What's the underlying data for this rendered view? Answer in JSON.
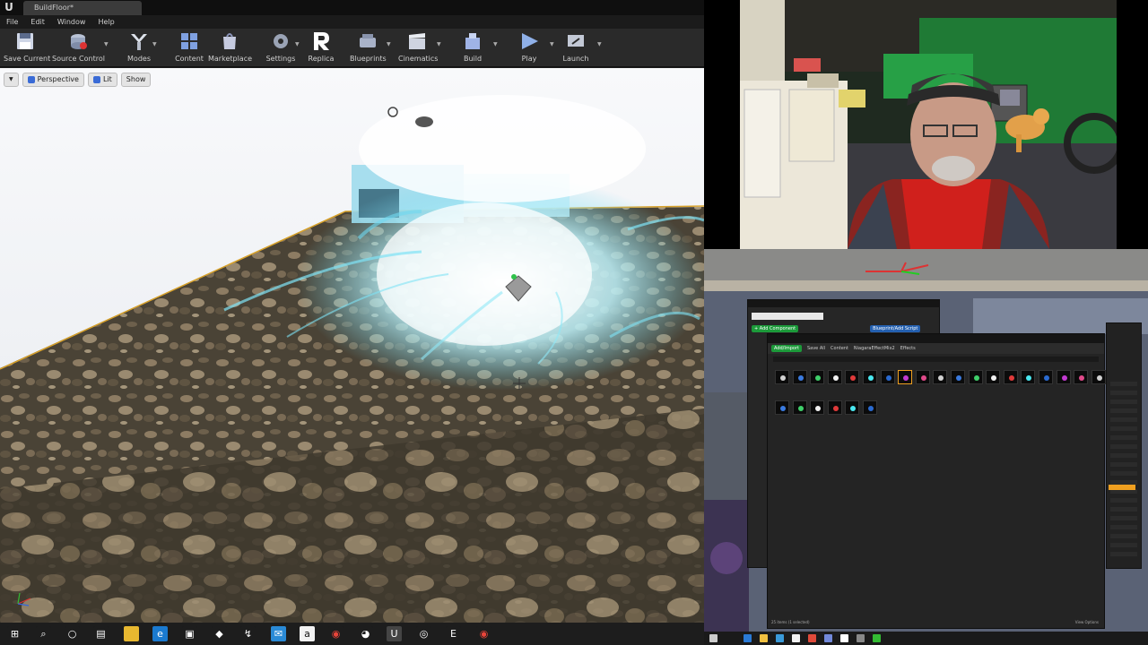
{
  "editor": {
    "tab_title": "BuildFloor*",
    "menu": [
      "File",
      "Edit",
      "Window",
      "Help"
    ],
    "toolbar": [
      {
        "label": "Save Current",
        "icon": "save-icon",
        "caret": false
      },
      {
        "label": "Source Control",
        "icon": "source-control-icon",
        "caret": true
      },
      {
        "label": "Modes",
        "icon": "modes-icon",
        "caret": true
      },
      {
        "label": "Content",
        "icon": "content-icon",
        "caret": false
      },
      {
        "label": "Marketplace",
        "icon": "marketplace-icon",
        "caret": false
      },
      {
        "label": "Settings",
        "icon": "settings-icon",
        "caret": true
      },
      {
        "label": "Replica",
        "icon": "replica-icon",
        "caret": false
      },
      {
        "label": "Blueprints",
        "icon": "blueprints-icon",
        "caret": true
      },
      {
        "label": "Cinematics",
        "icon": "cinematics-icon",
        "caret": true
      },
      {
        "label": "Build",
        "icon": "build-icon",
        "caret": true
      },
      {
        "label": "Play",
        "icon": "play-icon",
        "caret": true
      },
      {
        "label": "Launch",
        "icon": "launch-icon",
        "caret": true
      }
    ],
    "viewport": {
      "perspective_label": "Perspective",
      "lit_label": "Lit",
      "show_label": "Show"
    },
    "colors": {
      "particle": "#7fe3f5",
      "floor_edge": "#d7a12a",
      "sky": "#f3f5f7"
    }
  },
  "content_browser": {
    "add_import": "Add/Import",
    "save_all": "Save All",
    "breadcrumb": [
      "Content",
      "NiagaraEffectMix2",
      "Effects"
    ],
    "footer": "25 items (1 selected)",
    "view_options": "View Options",
    "item_count": 25
  },
  "details_panel": {
    "add_component": "+ Add Component",
    "blueprint_btn": "Blueprint/Add Script"
  },
  "taskbar": {
    "icons": [
      "windows-start-icon",
      "search-icon",
      "cortana-icon",
      "task-view-icon",
      "file-explorer-icon",
      "edge-icon",
      "store-icon",
      "dropbox-icon",
      "sourcetree-icon",
      "mail-icon",
      "amazon-icon",
      "chrome-icon",
      "discord-icon",
      "unreal-icon",
      "unity-icon",
      "epic-icon",
      "chrome-alt-icon"
    ]
  }
}
